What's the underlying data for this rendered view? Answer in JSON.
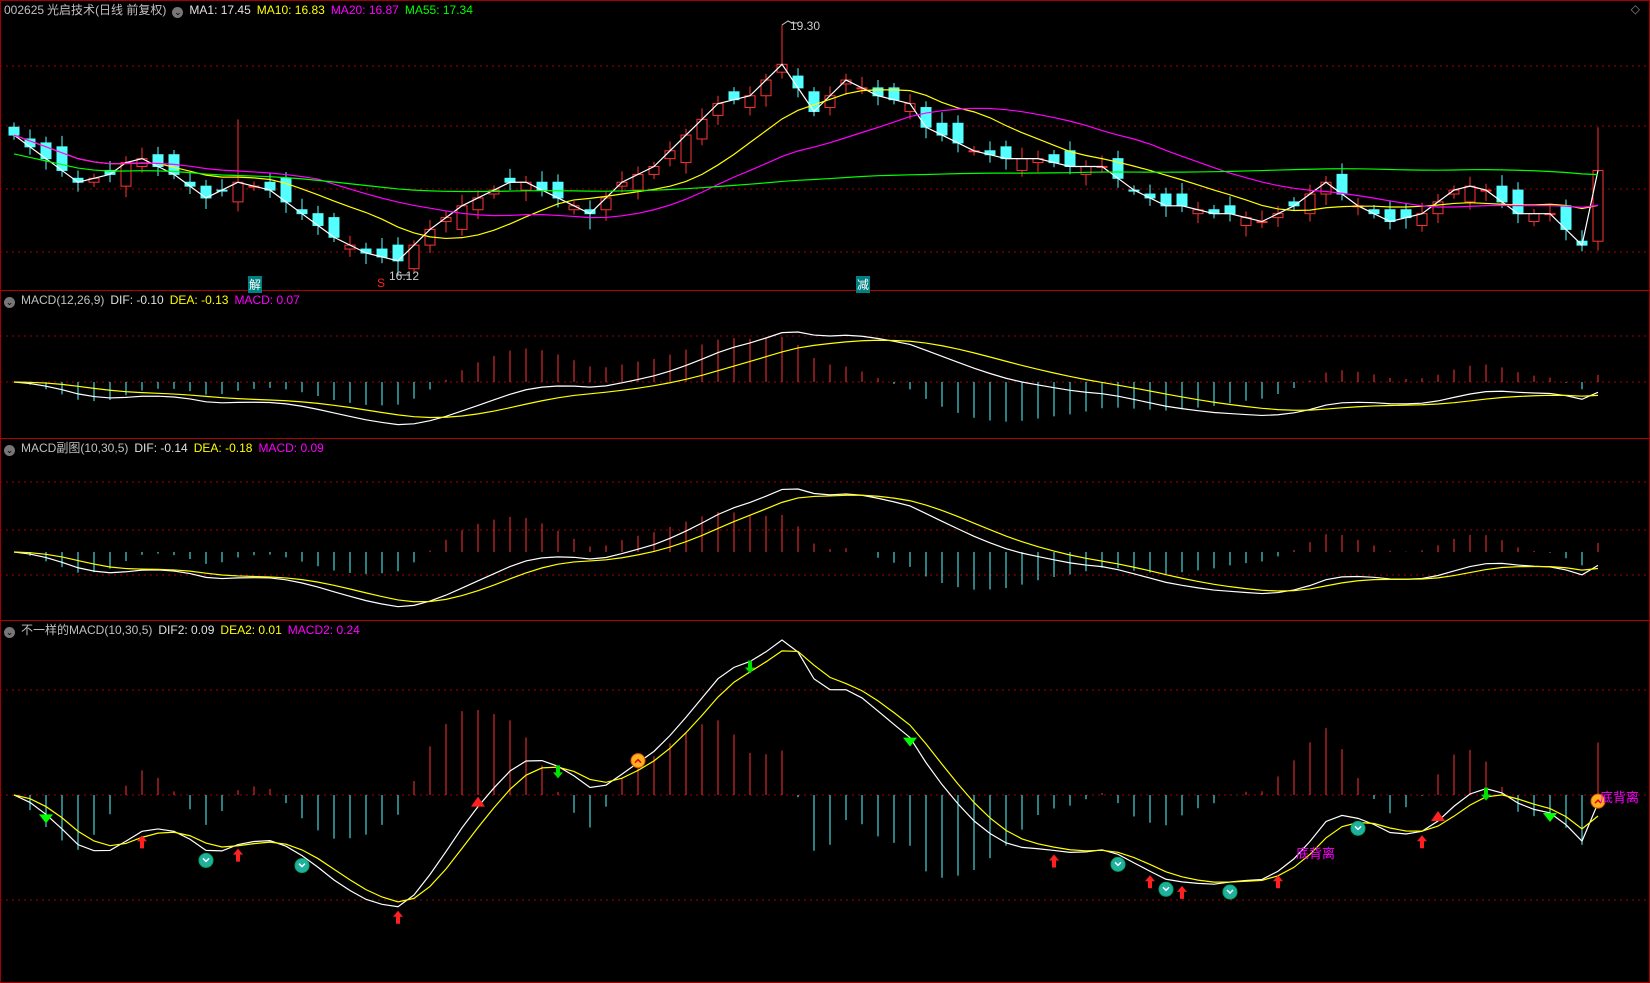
{
  "price_panel": {
    "code": "002625",
    "name": "光启技术",
    "period": "(日线 前复权)",
    "ma1": "MA1: 17.45",
    "ma10": "MA10: 16.83",
    "ma20": "MA20: 16.87",
    "ma55": "MA55: 17.34",
    "high_label": "19.30",
    "low_label": "16.12",
    "tags": [
      {
        "text": "解",
        "index": 15
      },
      {
        "text": "S",
        "index": 23
      },
      {
        "text": "减",
        "index": 53
      }
    ]
  },
  "macd_panel": {
    "title": "MACD(12,26,9)",
    "dif": "DIF: -0.10",
    "dea": "DEA: -0.13",
    "macd": "MACD: 0.07"
  },
  "macd_sub_panel": {
    "title": "MACD副图(10,30,5)",
    "dif": "DIF: -0.14",
    "dea": "DEA: -0.18",
    "macd": "MACD: 0.09"
  },
  "macd2_panel": {
    "title": "不一样的MACD(10,30,5)",
    "dif": "DIF2: 0.09",
    "dea": "DEA2: 0.01",
    "macd": "MACD2: 0.24",
    "labels": [
      {
        "text": "底背离",
        "index": 80
      },
      {
        "text": "底背离",
        "index": 99
      }
    ],
    "markers": [
      {
        "type": "green-triangle",
        "index": 2
      },
      {
        "type": "red-arrow",
        "index": 8
      },
      {
        "type": "cyan-badge",
        "index": 12
      },
      {
        "type": "red-arrow",
        "index": 14
      },
      {
        "type": "cyan-badge",
        "index": 18
      },
      {
        "type": "red-arrow",
        "index": 24
      },
      {
        "type": "red-triangle",
        "index": 29
      },
      {
        "type": "green-arrow",
        "index": 34
      },
      {
        "type": "orange-badge",
        "index": 39
      },
      {
        "type": "green-arrow",
        "index": 46
      },
      {
        "type": "green-triangle",
        "index": 56
      },
      {
        "type": "red-arrow",
        "index": 65
      },
      {
        "type": "cyan-badge",
        "index": 69
      },
      {
        "type": "red-arrow",
        "index": 71
      },
      {
        "type": "cyan-badge",
        "index": 72
      },
      {
        "type": "red-arrow",
        "index": 73
      },
      {
        "type": "cyan-badge",
        "index": 76
      },
      {
        "type": "red-arrow",
        "index": 79
      },
      {
        "type": "cyan-badge",
        "index": 84
      },
      {
        "type": "red-arrow",
        "index": 88
      },
      {
        "type": "red-triangle",
        "index": 89
      },
      {
        "type": "green-arrow",
        "index": 92
      },
      {
        "type": "green-triangle",
        "index": 96
      },
      {
        "type": "orange-badge",
        "index": 99
      }
    ]
  },
  "colors": {
    "up": "#ff3232",
    "down": "#54ffff",
    "ma1": "#ffffff",
    "ma10": "#ffff00",
    "ma20": "#ff00ff",
    "ma55": "#00ff00",
    "grid": "#a00000"
  },
  "chart_data": {
    "type": "candlestick",
    "price_range": [
      16.12,
      19.3
    ],
    "closes": [
      17.9,
      17.75,
      17.6,
      17.45,
      17.3,
      17.35,
      17.4,
      17.55,
      17.6,
      17.5,
      17.4,
      17.25,
      17.1,
      17.2,
      17.3,
      17.25,
      17.2,
      17.05,
      16.9,
      16.75,
      16.6,
      16.5,
      16.4,
      16.35,
      16.3,
      16.5,
      16.7,
      16.85,
      17.0,
      17.1,
      17.2,
      17.3,
      17.3,
      17.2,
      17.1,
      17.0,
      16.9,
      17.1,
      17.3,
      17.4,
      17.5,
      17.7,
      17.9,
      18.1,
      18.3,
      18.35,
      18.4,
      18.6,
      18.8,
      18.5,
      18.2,
      18.4,
      18.6,
      18.5,
      18.4,
      18.35,
      18.3,
      18.0,
      17.9,
      17.8,
      17.7,
      17.65,
      17.6,
      17.6,
      17.6,
      17.55,
      17.5,
      17.5,
      17.5,
      17.35,
      17.2,
      17.1,
      17.0,
      17.0,
      16.95,
      16.9,
      16.9,
      16.85,
      16.8,
      16.9,
      17.0,
      17.15,
      17.3,
      17.15,
      17.0,
      16.9,
      16.8,
      16.85,
      16.9,
      17.05,
      17.2,
      17.25,
      17.2,
      17.05,
      16.9,
      16.9,
      16.9,
      16.7,
      16.5,
      17.45
    ]
  }
}
